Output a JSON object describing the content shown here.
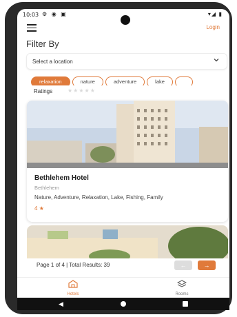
{
  "status": {
    "time": "10:03",
    "left_icons": "⚙ ◉ ▣",
    "right_icons": "▾◢ ▮"
  },
  "header": {
    "login": "Login"
  },
  "filter": {
    "title": "Filter By",
    "location_placeholder": "Select a location",
    "chips": [
      {
        "label": "relaxation",
        "active": true
      },
      {
        "label": "nature",
        "active": false
      },
      {
        "label": "adventure",
        "active": false
      },
      {
        "label": "lake",
        "active": false
      }
    ],
    "ratings_label": "Ratings",
    "ratings_stars": "★★★★★"
  },
  "hotel": {
    "name": "Bethlehem Hotel",
    "city": "Bethlehem",
    "tags": "Nature, Adventure, Relaxation, Lake, Fishing, Family",
    "rating": "4",
    "rating_star": "★"
  },
  "pagination": {
    "text": "Page 1 of 4 | Total Results: 39",
    "prev": "←",
    "next": "→"
  },
  "bottom_nav": {
    "hotels": "Hotels",
    "rooms": "Rooms"
  },
  "colors": {
    "accent": "#e07a3a"
  }
}
